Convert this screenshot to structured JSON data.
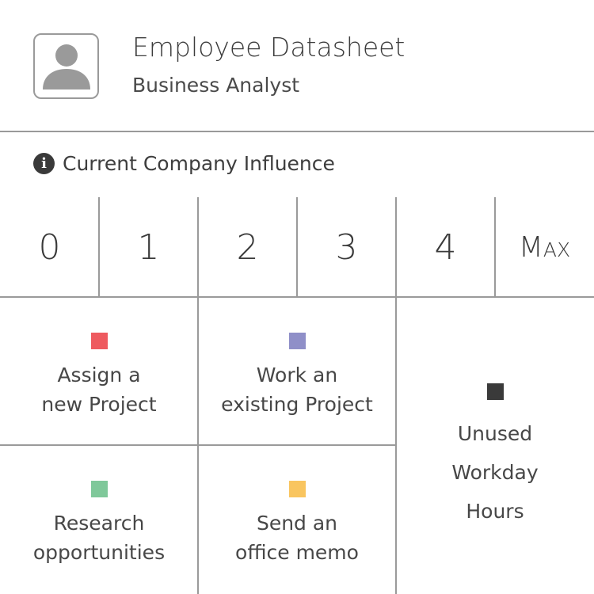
{
  "header": {
    "title": "Employee Datasheet",
    "subtitle": "Business Analyst",
    "avatar_icon": "user-silhouette-icon"
  },
  "influence": {
    "label": "Current Company Influence",
    "info_icon": "info-icon",
    "info_glyph": "i",
    "scale": [
      "0",
      "1",
      "2",
      "3",
      "4",
      "Max"
    ]
  },
  "actions": {
    "assign": {
      "line1": "Assign a",
      "line2": "new Project",
      "color": "#ee5a5f"
    },
    "work": {
      "line1": "Work an",
      "line2": "existing Project",
      "color": "#8f8fc8"
    },
    "research": {
      "line1": "Research",
      "line2": "opportunities",
      "color": "#7fc89a"
    },
    "memo": {
      "line1": "Send an",
      "line2": "office memo",
      "color": "#f9c55f"
    },
    "unused": {
      "line1": "Unused",
      "line2": "Workday",
      "line3": "Hours",
      "color": "#3a3a3a"
    }
  },
  "colors": {
    "divider": "#9a9a9a",
    "text": "#3a3a3a"
  }
}
